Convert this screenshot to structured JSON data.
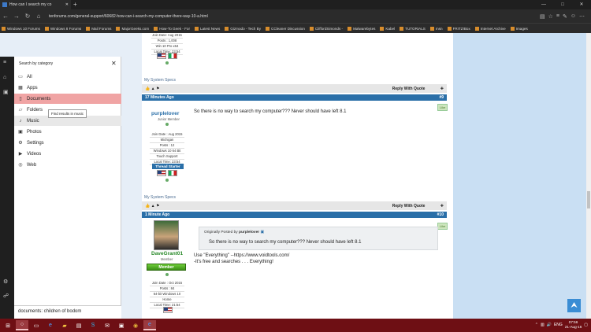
{
  "browser": {
    "tab_title": "How can I search my co",
    "new_tab": "+",
    "url": "tenforums.com/general-support/60682-how-can-i-search-my-computer-there-way-10-a.html",
    "window_controls": [
      "—",
      "□",
      "✕"
    ],
    "favorites": [
      "Windows 10 Forums",
      "Windows 8 Forums",
      "Mail Forums",
      "MajorGeeks.com",
      "How-To Geek - For",
      "Latest News",
      "Gizmodo - Tech By",
      "CCleaner Discussion",
      "CliffordSimonds -",
      "Malwarebytes",
      "Kabel",
      "TUTORIALS",
      "msn",
      "FRITZ!Box",
      "Internet Archive",
      "Images"
    ]
  },
  "forum": {
    "top_user": {
      "info": [
        "Join Date: Aug 2015",
        "Posts : 1,008",
        "Win 10 Pro x64",
        "Local Time: 23:54"
      ]
    },
    "specs_label": "My System Specs",
    "reply_label": "Reply With Quote",
    "post1": {
      "time": "17 Minutes Ago",
      "number": "#9",
      "username": "purplelover",
      "rank": "Junior Member",
      "info": [
        "Join Date : Aug 2015",
        "Michigan",
        "Posts : 12",
        "Windows 10 64 Bit",
        "Touch Support",
        "Local Time: 23:54"
      ],
      "badge": "Thread Starter",
      "text": "So there is no way to search my computer??? Never should have left 8.1",
      "like": "Like"
    },
    "post2": {
      "time": "1 Minute Ago",
      "number": "#10",
      "username": "DaveGrant01",
      "rank": "Member",
      "badge": "Member",
      "info": [
        "Join Date : Oct 2015",
        "Posts : 84",
        "64-bit Windows 10",
        "Home",
        "Local Time: 21:54"
      ],
      "quote_prefix": "Originally Posted by",
      "quote_author": "purplelover",
      "quote_text": "So there is no way to search my computer??? Never should have left 8.1",
      "line1": "Use \"Everything\" --https://www.voidtools.com/",
      "line2": "-It's free and searches . . . Everything!",
      "like": "Like"
    }
  },
  "search_panel": {
    "heading": "Search by category",
    "close": "✕",
    "categories": [
      "All",
      "Apps",
      "Documents",
      "Folders",
      "Music",
      "Photos",
      "Settings",
      "Videos",
      "Web"
    ],
    "selected": "Documents",
    "tooltip": "Find results in music",
    "query": "documents: children of bodom"
  },
  "taskbar": {
    "time": "07:56",
    "date": "21-Aug-16",
    "tray": "ENG"
  },
  "colors": {
    "taskbar": "#6e0f14",
    "post_header": "#2a6fa8",
    "selected_category": "#f0a4a4"
  }
}
